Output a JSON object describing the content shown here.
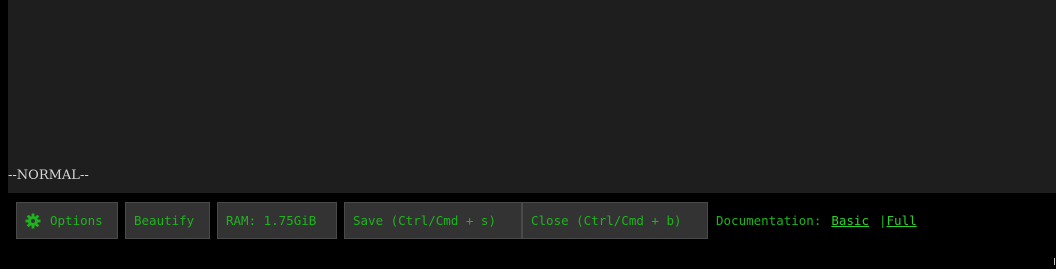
{
  "editor": {
    "mode": "--NORMAL--"
  },
  "toolbar": {
    "options_label": "Options",
    "options_icon": "gear-icon",
    "beautify_label": "Beautify",
    "ram_label": "RAM: 1.75GiB",
    "save_label": "Save (Ctrl/Cmd + s)",
    "close_label": "Close (Ctrl/Cmd + b)"
  },
  "docs": {
    "label": "Documentation:",
    "basic_link": "Basic",
    "separator": "|",
    "full_link": "Full"
  },
  "colors": {
    "editor_bg": "#1e1e1e",
    "page_bg": "#000000",
    "accent_green": "#1fb31f",
    "button_bg": "#333333"
  }
}
